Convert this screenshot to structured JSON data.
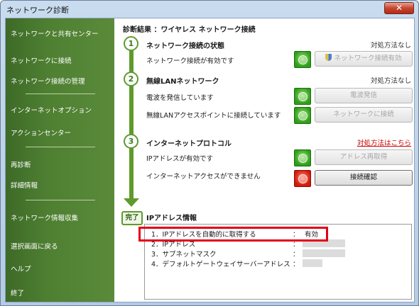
{
  "window": {
    "title": "ネットワーク診断",
    "close_label": "✕"
  },
  "sidebar": {
    "items": [
      "ネットワークと共有センター",
      "ネットワークに接続",
      "ネットワーク接続の管理",
      "インターネットオプション",
      "アクションセンター",
      "再診断",
      "詳細情報",
      "ネットワーク情報収集",
      "選択画面に戻る",
      "ヘルプ",
      "終了"
    ]
  },
  "main": {
    "result_title": "診断結果 ：ワイヤレス ネットワーク接続",
    "done_label": "完了",
    "sections": [
      {
        "number": "1",
        "title": "ネットワーク接続の状態",
        "status": "対処方法なし",
        "rows": [
          {
            "text": "ネットワーク接続が有効です",
            "result": "ok",
            "button": "ネットワーク接続有効",
            "enabled": false
          }
        ]
      },
      {
        "number": "2",
        "title": "無線LANネットワーク",
        "status": "対処方法なし",
        "rows": [
          {
            "text": "電波を発信しています",
            "result": "ok",
            "button": "電波発信",
            "enabled": false
          },
          {
            "text": "無線LANアクセスポイントに接続しています",
            "result": "ok",
            "button": "ネットワークに接続",
            "enabled": false
          }
        ]
      },
      {
        "number": "3",
        "title": "インターネットプロトコル",
        "link": "対処方法はこちら",
        "rows": [
          {
            "text": "IPアドレスが有効です",
            "result": "ok",
            "button": "アドレス再取得",
            "enabled": false
          },
          {
            "text": "インターネットアクセスができません",
            "result": "ng",
            "button": "接続確認",
            "enabled": true
          }
        ]
      }
    ],
    "ip_info": {
      "title": "IPアドレス情報",
      "rows": [
        {
          "label": "1．IPアドレスを自動的に取得する",
          "sep": "：",
          "value": "有効"
        },
        {
          "label": "2．IPアドレス",
          "sep": "：",
          "value": ""
        },
        {
          "label": "3．サブネットマスク",
          "sep": "：",
          "value": ""
        },
        {
          "label": "4．デフォルトゲートウェイサーバーアドレス",
          "sep": "：",
          "value": ""
        }
      ]
    }
  },
  "colors": {
    "sidebar_green": "#4f8032",
    "step_green": "#5e9a2c",
    "highlight_red": "#e3001b",
    "link_red": "#cc0000"
  }
}
